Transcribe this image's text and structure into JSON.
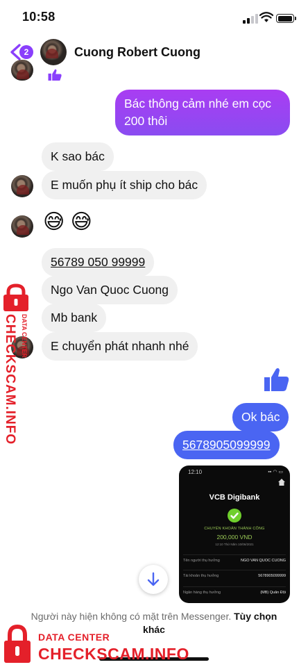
{
  "status_bar": {
    "time": "10:58",
    "signal_icon": "cellular-signal-icon",
    "wifi_icon": "wifi-icon",
    "battery_icon": "battery-icon"
  },
  "header": {
    "back_icon": "chevron-left-icon",
    "unread_count": "2",
    "contact_name": "Cuong Robert Cuong",
    "accent_color": "#8a3ffc"
  },
  "messages": {
    "outgoing_1": "Bác thông cảm nhé em cọc 200 thôi",
    "incoming_1": "K sao bác",
    "incoming_2": "E muốn phụ ít ship cho bác",
    "incoming_emojis": "😅 😅",
    "incoming_3": "56789 050 99999",
    "incoming_4": "Ngo Van Quoc Cuong",
    "incoming_5": "Mb bank",
    "incoming_6": "E chuyển phát nhanh nhé",
    "reaction_icon": "thumbs-up-icon",
    "outgoing_2": "Ok bác",
    "outgoing_3": "5678905099999"
  },
  "receipt": {
    "time": "12:10",
    "icons": "▪▪ ◠ ▭",
    "bank_logo": "VCB Digibank",
    "status": "CHUYỂN KHOẢN THÀNH CÔNG",
    "amount": "200,000 VND",
    "date": "12:10 Thứ Năm 10/06/2021",
    "rows": [
      {
        "label": "Tên người thụ hưởng",
        "value": "NGO VAN QUOC CUONG"
      },
      {
        "label": "Tài khoản thụ hưởng",
        "value": "5678905099999"
      },
      {
        "label": "Ngân hàng thụ hưởng",
        "value": "(MB) Quân Đội"
      }
    ]
  },
  "scroll_button_icon": "arrow-down-icon",
  "footer": {
    "note": "Người này hiện không có mặt trên Messenger.",
    "action": "Tùy chọn khác"
  },
  "watermark": {
    "small": "DATA CENTER",
    "big": "CHECKSCAM.INFO",
    "lock_icon": "padlock-icon",
    "color": "#e4202a"
  }
}
